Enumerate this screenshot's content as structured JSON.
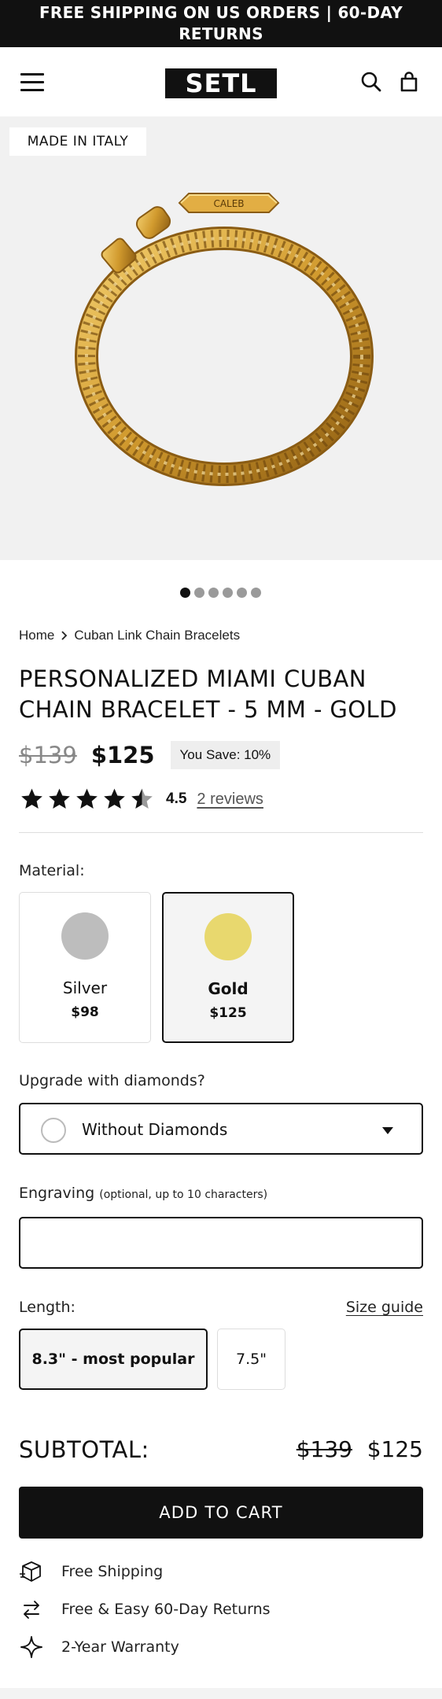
{
  "announcement": "FREE SHIPPING ON US ORDERS | 60-DAY RETURNS",
  "header": {
    "logo": "SETL"
  },
  "gallery": {
    "badge": "MADE IN ITALY",
    "engraving_text": "CALEB",
    "slide_count": 6,
    "active_slide": 0
  },
  "breadcrumb": {
    "home": "Home",
    "current": "Cuban Link Chain Bracelets"
  },
  "product": {
    "title": "PERSONALIZED MIAMI CUBAN CHAIN BRACELET - 5 MM - GOLD",
    "old_price": "$139",
    "price": "$125",
    "save": "You Save: 10%",
    "rating": "4.5",
    "reviews": "2 reviews"
  },
  "material": {
    "label": "Material:",
    "options": [
      {
        "name": "Silver",
        "price": "$98",
        "color": "#bdbdbd",
        "selected": false
      },
      {
        "name": "Gold",
        "price": "$125",
        "color": "#e8d86e",
        "selected": true
      }
    ]
  },
  "diamonds": {
    "label": "Upgrade with diamonds?",
    "value": "Without Diamonds"
  },
  "engraving": {
    "label": "Engraving",
    "hint": "(optional, up to 10 characters)",
    "value": ""
  },
  "length": {
    "label": "Length:",
    "size_guide": "Size guide",
    "options": [
      {
        "label": "8.3\" - most popular",
        "selected": true
      },
      {
        "label": "7.5\"",
        "selected": false
      }
    ]
  },
  "subtotal": {
    "label": "SUBTOTAL:",
    "old": "$139",
    "price": "$125"
  },
  "cta": "ADD TO CART",
  "perks": [
    {
      "icon": "box-icon",
      "text": "Free Shipping"
    },
    {
      "icon": "returns-icon",
      "text": "Free & Easy 60-Day Returns"
    },
    {
      "icon": "sparkle-icon",
      "text": "2-Year Warranty"
    }
  ],
  "colors": {
    "accent": "#111111",
    "gold": "#d9a63a",
    "gallery_bg": "#f1f1f1"
  }
}
